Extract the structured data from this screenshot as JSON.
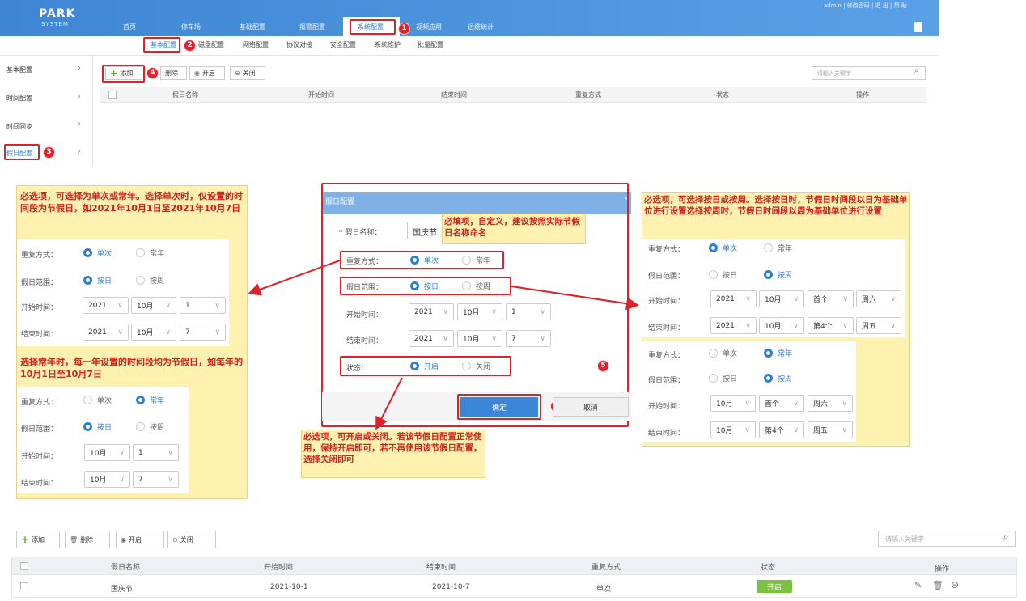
{
  "top": {
    "logo_main": "PARK",
    "logo_sub": "SYSTEM",
    "nav": [
      "首页",
      "停车场",
      "基础配置",
      "报警配置",
      "系统配置",
      "视频应用",
      "运维统计"
    ],
    "user_text": "admin | 修改密码 | 退 出 | 帮 助",
    "subnav": [
      "基本配置",
      "磁盘配置",
      "网络配置",
      "协议对接",
      "安全配置",
      "系统维护",
      "批量配置"
    ],
    "sidebar": [
      "基本配置",
      "时间配置",
      "时间同步",
      "假日配置"
    ],
    "toolbar": {
      "add": "添加",
      "delete": "删除",
      "enable": "开启",
      "disable": "关闭"
    },
    "search_placeholder": "请输入关键字",
    "columns": [
      "假日名称",
      "开始时间",
      "结束时间",
      "重复方式",
      "状态",
      "操作"
    ]
  },
  "markers": [
    "1",
    "2",
    "3",
    "4",
    "5",
    "6"
  ],
  "dialog": {
    "title": "假日配置",
    "name_label": "* 假日名称：",
    "name_value": "国庆节",
    "repeat_label": "重复方式：",
    "repeat_once": "单次",
    "repeat_yearly": "常年",
    "range_label": "假日范围：",
    "range_day": "按日",
    "range_week": "按周",
    "start_label": "开始时间：",
    "end_label": "结束时间：",
    "start": [
      "2021",
      "10月",
      "1"
    ],
    "end": [
      "2021",
      "10月",
      "7"
    ],
    "status_label": "状态：",
    "status_on": "开启",
    "status_off": "关闭",
    "ok": "确定",
    "cancel": "取消",
    "name_note": "必填项，自定义，建议按照实际节假日名称命名"
  },
  "left_panel": {
    "note1": "必选项，可选择为单次或常年。选择单次时，仅设置的时间段为节假日，如2021年10月1日至2021年10月7日",
    "note2": "选择常年时，每一年设置的时间段均为节假日，如每年的10月1日至10月7日",
    "once": {
      "start": [
        "2021",
        "10月",
        "1"
      ],
      "end": [
        "2021",
        "10月",
        "7"
      ]
    },
    "yearly": {
      "start": [
        "10月",
        "1"
      ],
      "end": [
        "10月",
        "7"
      ]
    }
  },
  "right_panel": {
    "note": "必选项，可选择按日或按周。选择按日时，节假日时间段以日为基础单位进行设置选择按周时，节假日时间段以周为基础单位进行设置",
    "once": {
      "start": [
        "2021",
        "10月",
        "首个",
        "周六"
      ],
      "end": [
        "2021",
        "10月",
        "第4个",
        "周五"
      ]
    },
    "yearly": {
      "start": [
        "10月",
        "首个",
        "周六"
      ],
      "end": [
        "10月",
        "第4个",
        "周五"
      ]
    }
  },
  "status_note": "必选项，可开启或关闭。若该节假日配置正常使用，保持开启即可，若不再使用该节假日配置，选择关闭即可",
  "bottom": {
    "row": {
      "name": "国庆节",
      "start": "2021-10-1",
      "end": "2021-10-7",
      "repeat": "单次",
      "status": "开启"
    },
    "status_color": "#7cc242"
  },
  "colors": {
    "accent": "#2d7fd6",
    "annotation": "#e0202a",
    "note_bg": "#fff2b0"
  },
  "icons": [
    "plus-icon",
    "trash-icon",
    "play-circle-icon",
    "minus-circle-icon",
    "search-icon",
    "chevron-right-icon",
    "chevron-down-icon",
    "edit-icon",
    "close-icon",
    "document-icon"
  ]
}
